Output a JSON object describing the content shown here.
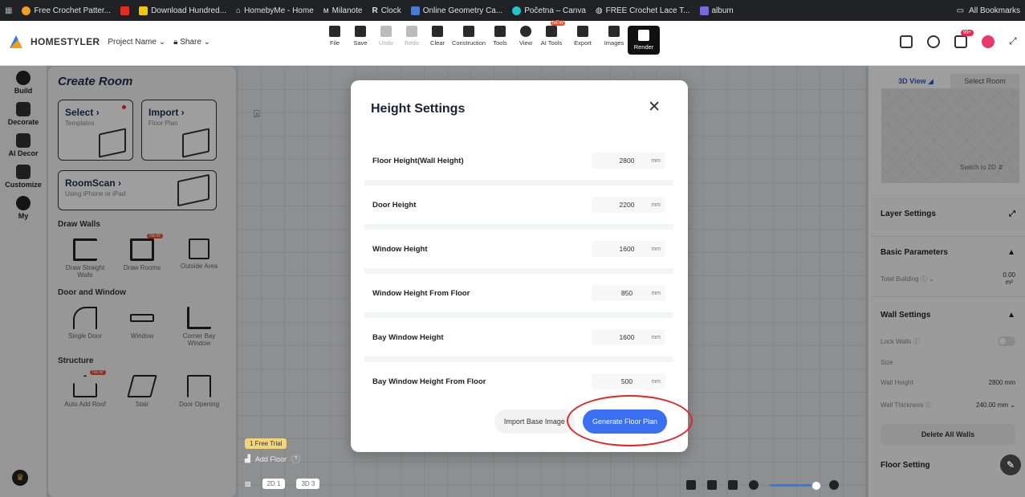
{
  "bookmarks": {
    "items": [
      {
        "label": "Free Crochet Patter...",
        "color": "#f0a020"
      },
      {
        "label": "",
        "color": "#e52d27"
      },
      {
        "label": "Download Hundred...",
        "color": "#f1c40f"
      },
      {
        "label": "HomebyMe - Home",
        "color": "#dfe1e5"
      },
      {
        "label": "Milanote",
        "color": "#dfe1e5"
      },
      {
        "label": "Clock",
        "color": "#dfe1e5"
      },
      {
        "label": "Online Geometry Ca...",
        "color": "#4a7bd0"
      },
      {
        "label": "Početna – Canva",
        "color": "#20c4cb"
      },
      {
        "label": "FREE Crochet Lace T...",
        "color": "#dfe1e5"
      },
      {
        "label": "album",
        "color": "#7a6ad8"
      }
    ],
    "all_label": "All Bookmarks"
  },
  "app": {
    "brand": "HOMESTYLER",
    "project_name": "Project Name",
    "share": "Share"
  },
  "toolbar": {
    "items": [
      "File",
      "Save",
      "Undo",
      "Redo",
      "Clear",
      "Construction",
      "Tools",
      "View",
      "AI Tools",
      "Export",
      "Images"
    ],
    "render": "Render",
    "new_tag": "NEW",
    "mail_badge": "99+"
  },
  "rail": {
    "items": [
      "Build",
      "Decorate",
      "AI Decor",
      "Customize",
      "My"
    ]
  },
  "create_room": {
    "title": "Create Room",
    "select": {
      "title": "Select",
      "sub": "Templates"
    },
    "import": {
      "title": "Import",
      "sub": "Floor Plan"
    },
    "roomscan": {
      "title": "RoomScan",
      "sub": "Using iPhone or iPad"
    },
    "draw_walls": {
      "heading": "Draw Walls",
      "tools": [
        "Draw Straight Walls",
        "Draw Rooms",
        "Outside Area"
      ]
    },
    "door_window": {
      "heading": "Door and Window",
      "tools": [
        "Single Door",
        "Window",
        "Corner Bay Window"
      ]
    },
    "structure": {
      "heading": "Structure",
      "tools": [
        "Auto Add Roof",
        "Stair",
        "Door Opening"
      ]
    },
    "new_tag": "NEW"
  },
  "canvas": {
    "trial": "1 Free Trial",
    "add_floor": "Add Floor",
    "help": "?",
    "view2d": "2D 1",
    "view3d": "3D 3"
  },
  "right_panel": {
    "tab_3d": "3D View",
    "tab_select": "Select Room",
    "switch_2d": "Switch to 2D",
    "layer_settings": "Layer Settings",
    "basic_parameters": "Basic Parameters",
    "total_building": "Total Building",
    "total_value": "0.00",
    "total_unit": "m²",
    "wall_settings": "Wall Settings",
    "lock_walls": "Lock Walls",
    "size": "Size",
    "wall_height": "Wall Height",
    "wall_height_value": "2800",
    "wall_height_unit": "mm",
    "wall_thickness": "Wall Thickness",
    "wall_thickness_value": "240.00",
    "wall_thickness_unit": "mm",
    "delete_all": "Delete All Walls",
    "floor_setting": "Floor Setting"
  },
  "modal": {
    "title": "Height Settings",
    "close": "✕",
    "rows": [
      {
        "label": "Floor Height(Wall Height)",
        "value": "2800",
        "unit": "mm"
      },
      {
        "label": "Door Height",
        "value": "2200",
        "unit": "mm"
      },
      {
        "label": "Window Height",
        "value": "1600",
        "unit": "mm"
      },
      {
        "label": "Window Height From Floor",
        "value": "850",
        "unit": "mm"
      },
      {
        "label": "Bay Window Height",
        "value": "1600",
        "unit": "mm"
      },
      {
        "label": "Bay Window Height From Floor",
        "value": "500",
        "unit": "mm"
      }
    ],
    "import_label": "Import Base Image",
    "generate_label": "Generate Floor Plan"
  },
  "colors": {
    "accent": "#3b6ff2",
    "highlight": "#e0262a",
    "new_tag": "#e8502a"
  }
}
